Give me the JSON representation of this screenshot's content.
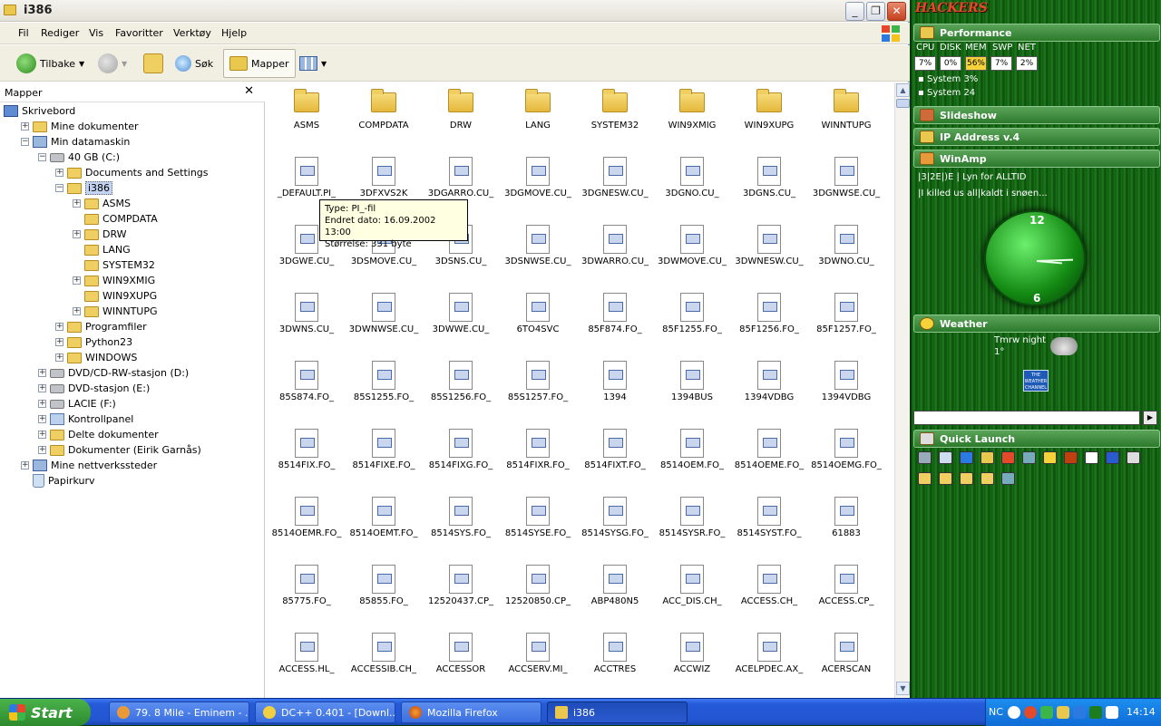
{
  "window": {
    "title": "i386"
  },
  "menu": [
    "Fil",
    "Rediger",
    "Vis",
    "Favoritter",
    "Verktøy",
    "Hjelp"
  ],
  "toolbar": {
    "back": "Tilbake",
    "search": "Søk",
    "folders": "Mapper"
  },
  "pane": {
    "title": "Mapper",
    "close": "✕",
    "tree": [
      {
        "label": "Skrivebord",
        "depth": 0,
        "exp": "",
        "icon": "de"
      },
      {
        "label": "Mine dokumenter",
        "depth": 1,
        "exp": "+",
        "icon": "fi"
      },
      {
        "label": "Min datamaskin",
        "depth": 1,
        "exp": "−",
        "icon": "pc"
      },
      {
        "label": "40 GB (C:)",
        "depth": 2,
        "exp": "−",
        "icon": "di"
      },
      {
        "label": "Documents and Settings",
        "depth": 3,
        "exp": "+",
        "icon": "fi"
      },
      {
        "label": "i386",
        "depth": 3,
        "exp": "−",
        "icon": "fi",
        "selected": true
      },
      {
        "label": "ASMS",
        "depth": 4,
        "exp": "+",
        "icon": "fi"
      },
      {
        "label": "COMPDATA",
        "depth": 4,
        "exp": "",
        "icon": "fi"
      },
      {
        "label": "DRW",
        "depth": 4,
        "exp": "+",
        "icon": "fi"
      },
      {
        "label": "LANG",
        "depth": 4,
        "exp": "",
        "icon": "fi"
      },
      {
        "label": "SYSTEM32",
        "depth": 4,
        "exp": "",
        "icon": "fi"
      },
      {
        "label": "WIN9XMIG",
        "depth": 4,
        "exp": "+",
        "icon": "fi"
      },
      {
        "label": "WIN9XUPG",
        "depth": 4,
        "exp": "",
        "icon": "fi"
      },
      {
        "label": "WINNTUPG",
        "depth": 4,
        "exp": "+",
        "icon": "fi"
      },
      {
        "label": "Programfiler",
        "depth": 3,
        "exp": "+",
        "icon": "fi"
      },
      {
        "label": "Python23",
        "depth": 3,
        "exp": "+",
        "icon": "fi"
      },
      {
        "label": "WINDOWS",
        "depth": 3,
        "exp": "+",
        "icon": "fi"
      },
      {
        "label": "DVD/CD-RW-stasjon (D:)",
        "depth": 2,
        "exp": "+",
        "icon": "di"
      },
      {
        "label": "DVD-stasjon (E:)",
        "depth": 2,
        "exp": "+",
        "icon": "di"
      },
      {
        "label": "LACIE (F:)",
        "depth": 2,
        "exp": "+",
        "icon": "di"
      },
      {
        "label": "Kontrollpanel",
        "depth": 2,
        "exp": "+",
        "icon": "cp"
      },
      {
        "label": "Delte dokumenter",
        "depth": 2,
        "exp": "+",
        "icon": "fi"
      },
      {
        "label": "Dokumenter (Eirik Garnås)",
        "depth": 2,
        "exp": "+",
        "icon": "fi"
      },
      {
        "label": "Mine nettverkssteder",
        "depth": 1,
        "exp": "+",
        "icon": "pc"
      },
      {
        "label": "Papirkurv",
        "depth": 1,
        "exp": "",
        "icon": "rb"
      }
    ]
  },
  "files": [
    {
      "name": "ASMS",
      "type": "folder"
    },
    {
      "name": "COMPDATA",
      "type": "folder"
    },
    {
      "name": "DRW",
      "type": "folder"
    },
    {
      "name": "LANG",
      "type": "folder"
    },
    {
      "name": "SYSTEM32",
      "type": "folder"
    },
    {
      "name": "WIN9XMIG",
      "type": "folder"
    },
    {
      "name": "WIN9XUPG",
      "type": "folder"
    },
    {
      "name": "WINNTUPG",
      "type": "folder"
    },
    {
      "name": "_DEFAULT.PI_",
      "type": "file"
    },
    {
      "name": "3DFXVS2K",
      "type": "file"
    },
    {
      "name": "3DGARRO.CU_",
      "type": "file"
    },
    {
      "name": "3DGMOVE.CU_",
      "type": "file"
    },
    {
      "name": "3DGNESW.CU_",
      "type": "file"
    },
    {
      "name": "3DGNO.CU_",
      "type": "file"
    },
    {
      "name": "3DGNS.CU_",
      "type": "file"
    },
    {
      "name": "3DGNWSE.CU_",
      "type": "file"
    },
    {
      "name": "3DGWE.CU_",
      "type": "file"
    },
    {
      "name": "3DSMOVE.CU_",
      "type": "file"
    },
    {
      "name": "3DSNS.CU_",
      "type": "file"
    },
    {
      "name": "3DSNWSE.CU_",
      "type": "file"
    },
    {
      "name": "3DWARRO.CU_",
      "type": "file"
    },
    {
      "name": "3DWMOVE.CU_",
      "type": "file"
    },
    {
      "name": "3DWNESW.CU_",
      "type": "file"
    },
    {
      "name": "3DWNO.CU_",
      "type": "file"
    },
    {
      "name": "3DWNS.CU_",
      "type": "file"
    },
    {
      "name": "3DWNWSE.CU_",
      "type": "file"
    },
    {
      "name": "3DWWE.CU_",
      "type": "file"
    },
    {
      "name": "6TO4SVC",
      "type": "file"
    },
    {
      "name": "85F874.FO_",
      "type": "file"
    },
    {
      "name": "85F1255.FO_",
      "type": "file"
    },
    {
      "name": "85F1256.FO_",
      "type": "file"
    },
    {
      "name": "85F1257.FO_",
      "type": "file"
    },
    {
      "name": "85S874.FO_",
      "type": "file"
    },
    {
      "name": "85S1255.FO_",
      "type": "file"
    },
    {
      "name": "85S1256.FO_",
      "type": "file"
    },
    {
      "name": "85S1257.FO_",
      "type": "file"
    },
    {
      "name": "1394",
      "type": "file"
    },
    {
      "name": "1394BUS",
      "type": "file"
    },
    {
      "name": "1394VDBG",
      "type": "file"
    },
    {
      "name": "1394VDBG",
      "type": "file"
    },
    {
      "name": "8514FIX.FO_",
      "type": "file"
    },
    {
      "name": "8514FIXE.FO_",
      "type": "file"
    },
    {
      "name": "8514FIXG.FO_",
      "type": "file"
    },
    {
      "name": "8514FIXR.FO_",
      "type": "file"
    },
    {
      "name": "8514FIXT.FO_",
      "type": "file"
    },
    {
      "name": "8514OEM.FO_",
      "type": "file"
    },
    {
      "name": "8514OEME.FO_",
      "type": "file"
    },
    {
      "name": "8514OEMG.FO_",
      "type": "file"
    },
    {
      "name": "8514OEMR.FO_",
      "type": "file"
    },
    {
      "name": "8514OEMT.FO_",
      "type": "file"
    },
    {
      "name": "8514SYS.FO_",
      "type": "file"
    },
    {
      "name": "8514SYSE.FO_",
      "type": "file"
    },
    {
      "name": "8514SYSG.FO_",
      "type": "file"
    },
    {
      "name": "8514SYSR.FO_",
      "type": "file"
    },
    {
      "name": "8514SYST.FO_",
      "type": "file"
    },
    {
      "name": "61883",
      "type": "file"
    },
    {
      "name": "85775.FO_",
      "type": "file"
    },
    {
      "name": "85855.FO_",
      "type": "file"
    },
    {
      "name": "12520437.CP_",
      "type": "file"
    },
    {
      "name": "12520850.CP_",
      "type": "file"
    },
    {
      "name": "ABP480N5",
      "type": "file"
    },
    {
      "name": "ACC_DIS.CH_",
      "type": "file"
    },
    {
      "name": "ACCESS.CH_",
      "type": "file"
    },
    {
      "name": "ACCESS.CP_",
      "type": "file"
    },
    {
      "name": "ACCESS.HL_",
      "type": "file"
    },
    {
      "name": "ACCESSIB.CH_",
      "type": "file"
    },
    {
      "name": "ACCESSOR",
      "type": "file"
    },
    {
      "name": "ACCSERV.MI_",
      "type": "file"
    },
    {
      "name": "ACCTRES",
      "type": "file"
    },
    {
      "name": "ACCWIZ",
      "type": "file"
    },
    {
      "name": "ACELPDEC.AX_",
      "type": "file"
    },
    {
      "name": "ACERSCAN",
      "type": "file"
    }
  ],
  "tooltip": {
    "type": "Type: PI_-fil",
    "date": "Endret dato: 16.09.2002 13:00",
    "size": "Størrelse: 331 byte"
  },
  "sidebar": {
    "brand": "HACKERS",
    "performance": {
      "title": "Performance",
      "labels": [
        "CPU",
        "DISK",
        "MEM",
        "SWP",
        "NET"
      ],
      "values": [
        "7%",
        "0%",
        "56%",
        "7%",
        "2%"
      ],
      "sys1": "System 3%",
      "sys2": "System 24"
    },
    "slideshow": "Slideshow",
    "ip": "IP Address v.4",
    "winamp": {
      "title": "WinAmp",
      "line1": "|3|2E|)E | Lyn for ALLTID",
      "line2": "|I killed us all|kaldt i snøen..."
    },
    "clock_numbers": [
      "12",
      "6"
    ],
    "weather": {
      "title": "Weather",
      "when": "Tmrw night",
      "temp": "1°",
      "channel": "THE WEATHER CHANNEL"
    },
    "quicklaunch": "Quick Launch"
  },
  "taskbar": {
    "start": "Start",
    "items": [
      "79. 8 Mile - Eminem - ...",
      "DC++ 0.401 - [Downl...",
      "Mozilla Firefox",
      "i386"
    ],
    "tray_text": "NC",
    "time": "14:14"
  },
  "colors": {
    "accent": "#316ac5",
    "green": "#1d7c1d",
    "task": "#245ad8"
  }
}
